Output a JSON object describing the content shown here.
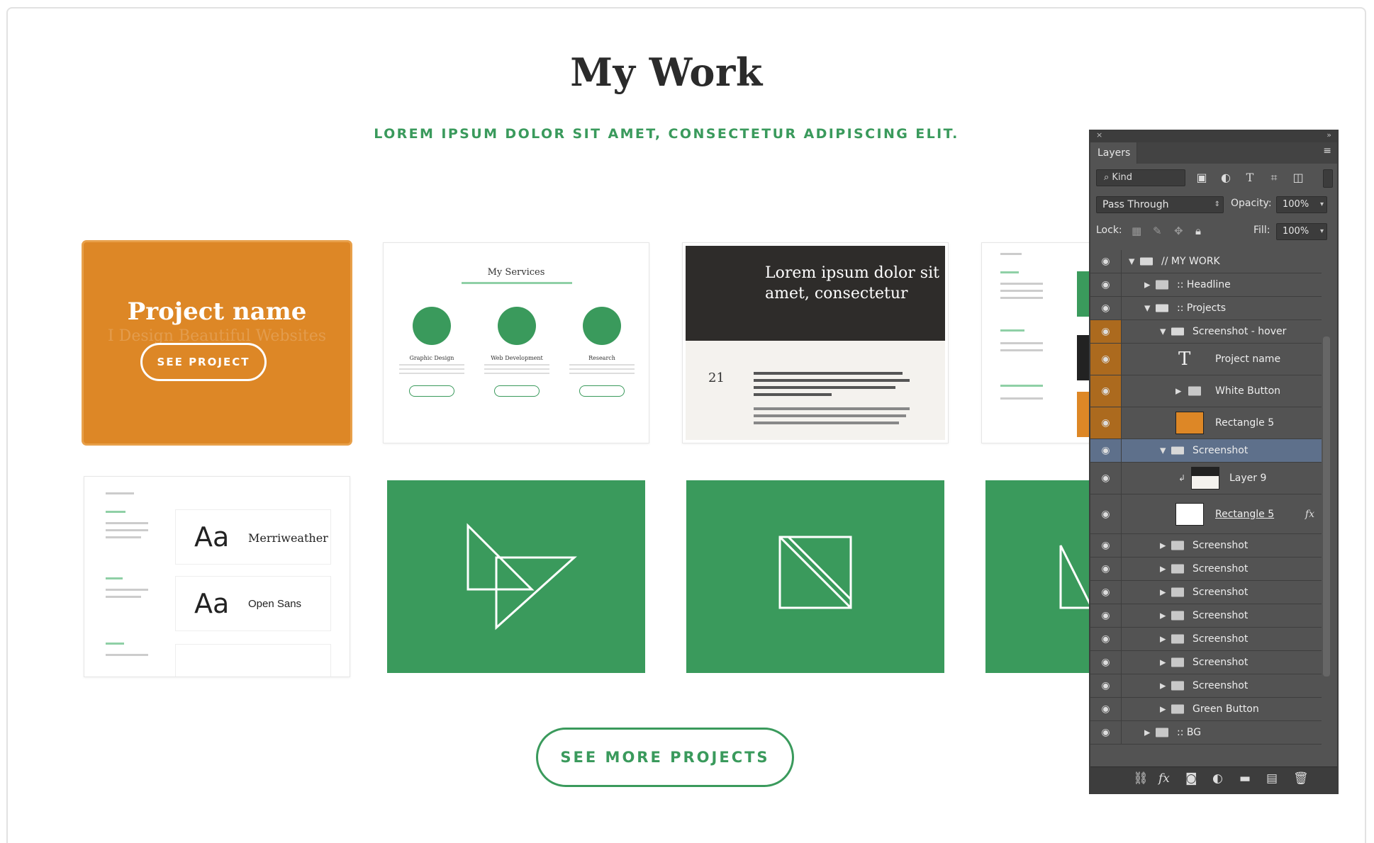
{
  "page": {
    "title": "My Work",
    "subtitle": "LOREM IPSUM DOLOR SIT AMET, CONSECTETUR ADIPISCING ELIT.",
    "more_button": "SEE MORE PROJECTS"
  },
  "colors": {
    "green": "#3a9a5c",
    "orange": "#dd8726",
    "panel_bg": "#535353",
    "selected_row": "#5e708b"
  },
  "cards": {
    "hover": {
      "project_name": "Project name",
      "ghost_text": "I Design Beautiful Websites",
      "button": "SEE PROJECT"
    },
    "services": {
      "title": "My Services",
      "columns": [
        "Graphic Design",
        "Web Development",
        "Research"
      ]
    },
    "blog": {
      "headline": "Lorem ipsum dolor sit amet, consectetur adipiscing elit.",
      "day": "21"
    },
    "typography": {
      "fonts": [
        "Merriweather",
        "Open Sans"
      ],
      "sample": "Aa"
    }
  },
  "layers_panel": {
    "tab": "Layers",
    "filter": "Kind",
    "blend_mode": "Pass Through",
    "opacity_label": "Opacity:",
    "opacity_value": "100%",
    "lock_label": "Lock:",
    "fill_label": "Fill:",
    "fill_value": "100%",
    "layers": [
      {
        "name": "// MY WORK",
        "type": "group",
        "expanded": true,
        "depth": 0
      },
      {
        "name": ":: Headline",
        "type": "group",
        "expanded": false,
        "depth": 1
      },
      {
        "name": ":: Projects",
        "type": "group",
        "expanded": true,
        "depth": 1
      },
      {
        "name": "Screenshot - hover",
        "type": "group",
        "expanded": true,
        "depth": 2
      },
      {
        "name": "Project name",
        "type": "text",
        "depth": 3
      },
      {
        "name": "White Button",
        "type": "group",
        "expanded": false,
        "depth": 3
      },
      {
        "name": "Rectangle 5",
        "type": "shape",
        "depth": 3
      },
      {
        "name": "Screenshot",
        "type": "group",
        "expanded": true,
        "depth": 2,
        "selected": true
      },
      {
        "name": "Layer 9",
        "type": "image",
        "depth": 3
      },
      {
        "name": "Rectangle 5",
        "type": "shape",
        "depth": 3,
        "fx": "fx"
      },
      {
        "name": "Screenshot",
        "type": "group",
        "expanded": false,
        "depth": 2
      },
      {
        "name": "Screenshot",
        "type": "group",
        "expanded": false,
        "depth": 2
      },
      {
        "name": "Screenshot",
        "type": "group",
        "expanded": false,
        "depth": 2
      },
      {
        "name": "Screenshot",
        "type": "group",
        "expanded": false,
        "depth": 2
      },
      {
        "name": "Screenshot",
        "type": "group",
        "expanded": false,
        "depth": 2
      },
      {
        "name": "Screenshot",
        "type": "group",
        "expanded": false,
        "depth": 2
      },
      {
        "name": "Screenshot",
        "type": "group",
        "expanded": false,
        "depth": 2
      },
      {
        "name": "Green Button",
        "type": "group",
        "expanded": false,
        "depth": 2
      },
      {
        "name": ":: BG",
        "type": "group",
        "expanded": false,
        "depth": 1
      }
    ]
  }
}
